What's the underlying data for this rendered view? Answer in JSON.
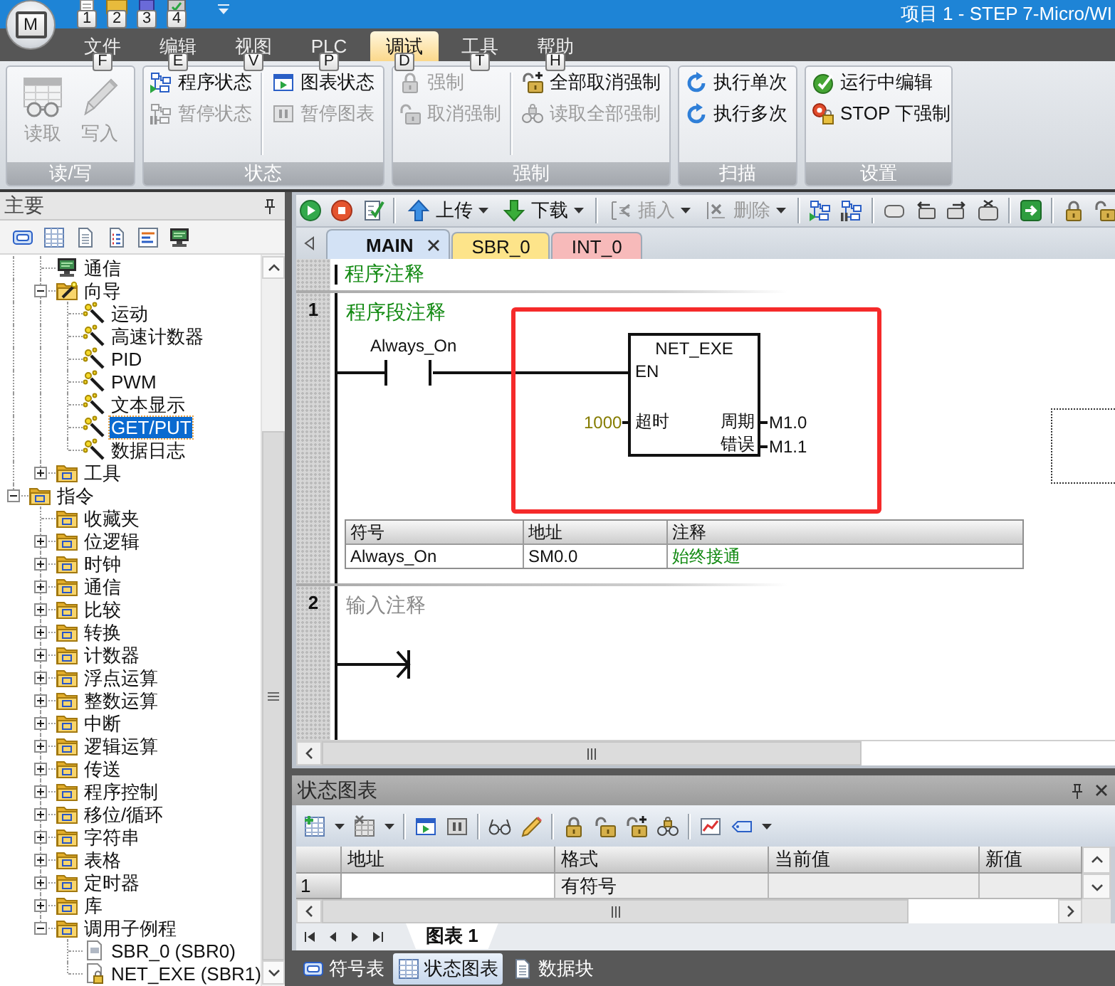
{
  "window": {
    "title": "项目 1 - STEP 7-Micro/WI",
    "app_button_keytip": "M"
  },
  "quick_access": {
    "keytips": [
      "1",
      "2",
      "3",
      "4"
    ]
  },
  "menu_tabs": [
    {
      "label": "文件",
      "keytip": "F",
      "selected": false
    },
    {
      "label": "编辑",
      "keytip": "E",
      "selected": false
    },
    {
      "label": "视图",
      "keytip": "V",
      "selected": false
    },
    {
      "label": "PLC",
      "keytip": "P",
      "selected": false
    },
    {
      "label": "调试",
      "keytip": "D",
      "selected": true
    },
    {
      "label": "工具",
      "keytip": "T",
      "selected": false
    },
    {
      "label": "帮助",
      "keytip": "H",
      "selected": false
    }
  ],
  "ribbon": {
    "groups": [
      {
        "title": "读/写",
        "kind": "large",
        "columns": [
          [
            {
              "label": "读取",
              "disabled": true
            }
          ],
          [
            {
              "label": "写入",
              "disabled": true
            }
          ]
        ]
      },
      {
        "title": "状态",
        "kind": "small",
        "columns": [
          [
            {
              "label": "程序状态",
              "disabled": false
            },
            {
              "label": "暂停状态",
              "disabled": true
            }
          ],
          [
            {
              "label": "图表状态",
              "disabled": false
            },
            {
              "label": "暂停图表",
              "disabled": true
            }
          ]
        ]
      },
      {
        "title": "强制",
        "kind": "small",
        "columns": [
          [
            {
              "label": "强制",
              "disabled": true
            },
            {
              "label": "取消强制",
              "disabled": true
            }
          ],
          [
            {
              "label": "全部取消强制",
              "disabled": false
            },
            {
              "label": "读取全部强制",
              "disabled": true
            }
          ]
        ]
      },
      {
        "title": "扫描",
        "kind": "small",
        "columns": [
          [
            {
              "label": "执行单次",
              "disabled": false
            },
            {
              "label": "执行多次",
              "disabled": false
            }
          ]
        ]
      },
      {
        "title": "设置",
        "kind": "small",
        "columns": [
          [
            {
              "label": "运行中编辑",
              "disabled": false
            },
            {
              "label": "STOP 下强制",
              "disabled": false
            }
          ]
        ]
      }
    ]
  },
  "navigation": {
    "title": "主要",
    "tree": {
      "continued_items": [
        {
          "label": "通信",
          "kind": "monitor",
          "selected": false
        },
        {
          "label": "向导",
          "kind": "wizard-folder",
          "expanded": true,
          "selected": false,
          "children": [
            {
              "label": "运动",
              "kind": "wand",
              "selected": false
            },
            {
              "label": "高速计数器",
              "kind": "wand",
              "selected": false
            },
            {
              "label": "PID",
              "kind": "wand",
              "selected": false
            },
            {
              "label": "PWM",
              "kind": "wand",
              "selected": false
            },
            {
              "label": "文本显示",
              "kind": "wand",
              "selected": false
            },
            {
              "label": "GET/PUT",
              "kind": "wand",
              "selected": true
            },
            {
              "label": "数据日志",
              "kind": "wand",
              "selected": false
            }
          ]
        },
        {
          "label": "工具",
          "kind": "folder",
          "expanded": false,
          "selected": false
        }
      ],
      "items": [
        {
          "label": "指令",
          "kind": "folder",
          "expanded": true,
          "selected": false,
          "children": [
            {
              "label": "收藏夹",
              "kind": "folder",
              "selected": false
            },
            {
              "label": "位逻辑",
              "kind": "folder",
              "expanded": false,
              "selected": false
            },
            {
              "label": "时钟",
              "kind": "folder",
              "expanded": false,
              "selected": false
            },
            {
              "label": "通信",
              "kind": "folder",
              "expanded": false,
              "selected": false
            },
            {
              "label": "比较",
              "kind": "folder",
              "expanded": false,
              "selected": false
            },
            {
              "label": "转换",
              "kind": "folder",
              "expanded": false,
              "selected": false
            },
            {
              "label": "计数器",
              "kind": "folder",
              "expanded": false,
              "selected": false
            },
            {
              "label": "浮点运算",
              "kind": "folder",
              "expanded": false,
              "selected": false
            },
            {
              "label": "整数运算",
              "kind": "folder",
              "expanded": false,
              "selected": false
            },
            {
              "label": "中断",
              "kind": "folder",
              "expanded": false,
              "selected": false
            },
            {
              "label": "逻辑运算",
              "kind": "folder",
              "expanded": false,
              "selected": false
            },
            {
              "label": "传送",
              "kind": "folder",
              "expanded": false,
              "selected": false
            },
            {
              "label": "程序控制",
              "kind": "folder",
              "expanded": false,
              "selected": false
            },
            {
              "label": "移位/循环",
              "kind": "folder",
              "expanded": false,
              "selected": false
            },
            {
              "label": "字符串",
              "kind": "folder",
              "expanded": false,
              "selected": false
            },
            {
              "label": "表格",
              "kind": "folder",
              "expanded": false,
              "selected": false
            },
            {
              "label": "定时器",
              "kind": "folder",
              "expanded": false,
              "selected": false
            },
            {
              "label": "库",
              "kind": "folder",
              "expanded": false,
              "selected": false
            },
            {
              "label": "调用子例程",
              "kind": "folder",
              "expanded": true,
              "selected": false,
              "children": [
                {
                  "label": "SBR_0 (SBR0)",
                  "kind": "page",
                  "selected": false
                },
                {
                  "label": "NET_EXE (SBR1)",
                  "kind": "locked-page",
                  "selected": false
                }
              ]
            }
          ]
        }
      ]
    }
  },
  "editor": {
    "toolbar": {
      "buttons": [
        {
          "label": "上传",
          "disabled": false
        },
        {
          "label": "下载",
          "disabled": false
        },
        {
          "label": "插入",
          "disabled": true
        },
        {
          "label": "删除",
          "disabled": true
        }
      ]
    },
    "tabs": [
      {
        "label": "MAIN",
        "selected": true,
        "color": "#d3e2f5"
      },
      {
        "label": "SBR_0",
        "selected": false,
        "color": "#fde48a"
      },
      {
        "label": "INT_0",
        "selected": false,
        "color": "#f7baba"
      }
    ],
    "program_comment": "程序注释",
    "networks": [
      {
        "number": "1",
        "comment": "程序段注释",
        "cursor": true,
        "rung": {
          "kind": "contact-box",
          "contact": "Always_On",
          "box": {
            "title": "NET_EXE",
            "enable": "EN",
            "highlighted": true,
            "inputs": [
              {
                "pin": "超时",
                "operand": "1000"
              }
            ],
            "outputs": [
              {
                "pin": "周期",
                "operand": "M1.0"
              },
              {
                "pin": "错误",
                "operand": "M1.1"
              }
            ]
          }
        },
        "symbols": {
          "columns": [
            "符号",
            "地址",
            "注释"
          ],
          "rows": [
            [
              "Always_On",
              "SM0.0",
              "始终接通"
            ]
          ]
        }
      },
      {
        "number": "2",
        "placeholder": "输入注释",
        "rung": {
          "kind": "open"
        }
      }
    ]
  },
  "status_chart": {
    "title": "状态图表",
    "columns": [
      "地址",
      "格式",
      "当前值",
      "新值"
    ],
    "rows": [
      {
        "number": "1",
        "format": "有符号"
      }
    ],
    "sheet_tabs": [
      {
        "label": "图表 1",
        "selected": true
      }
    ]
  },
  "bottom_tabs": [
    {
      "label": "符号表",
      "selected": false
    },
    {
      "label": "状态图表",
      "selected": true
    },
    {
      "label": "数据块",
      "selected": false
    }
  ]
}
